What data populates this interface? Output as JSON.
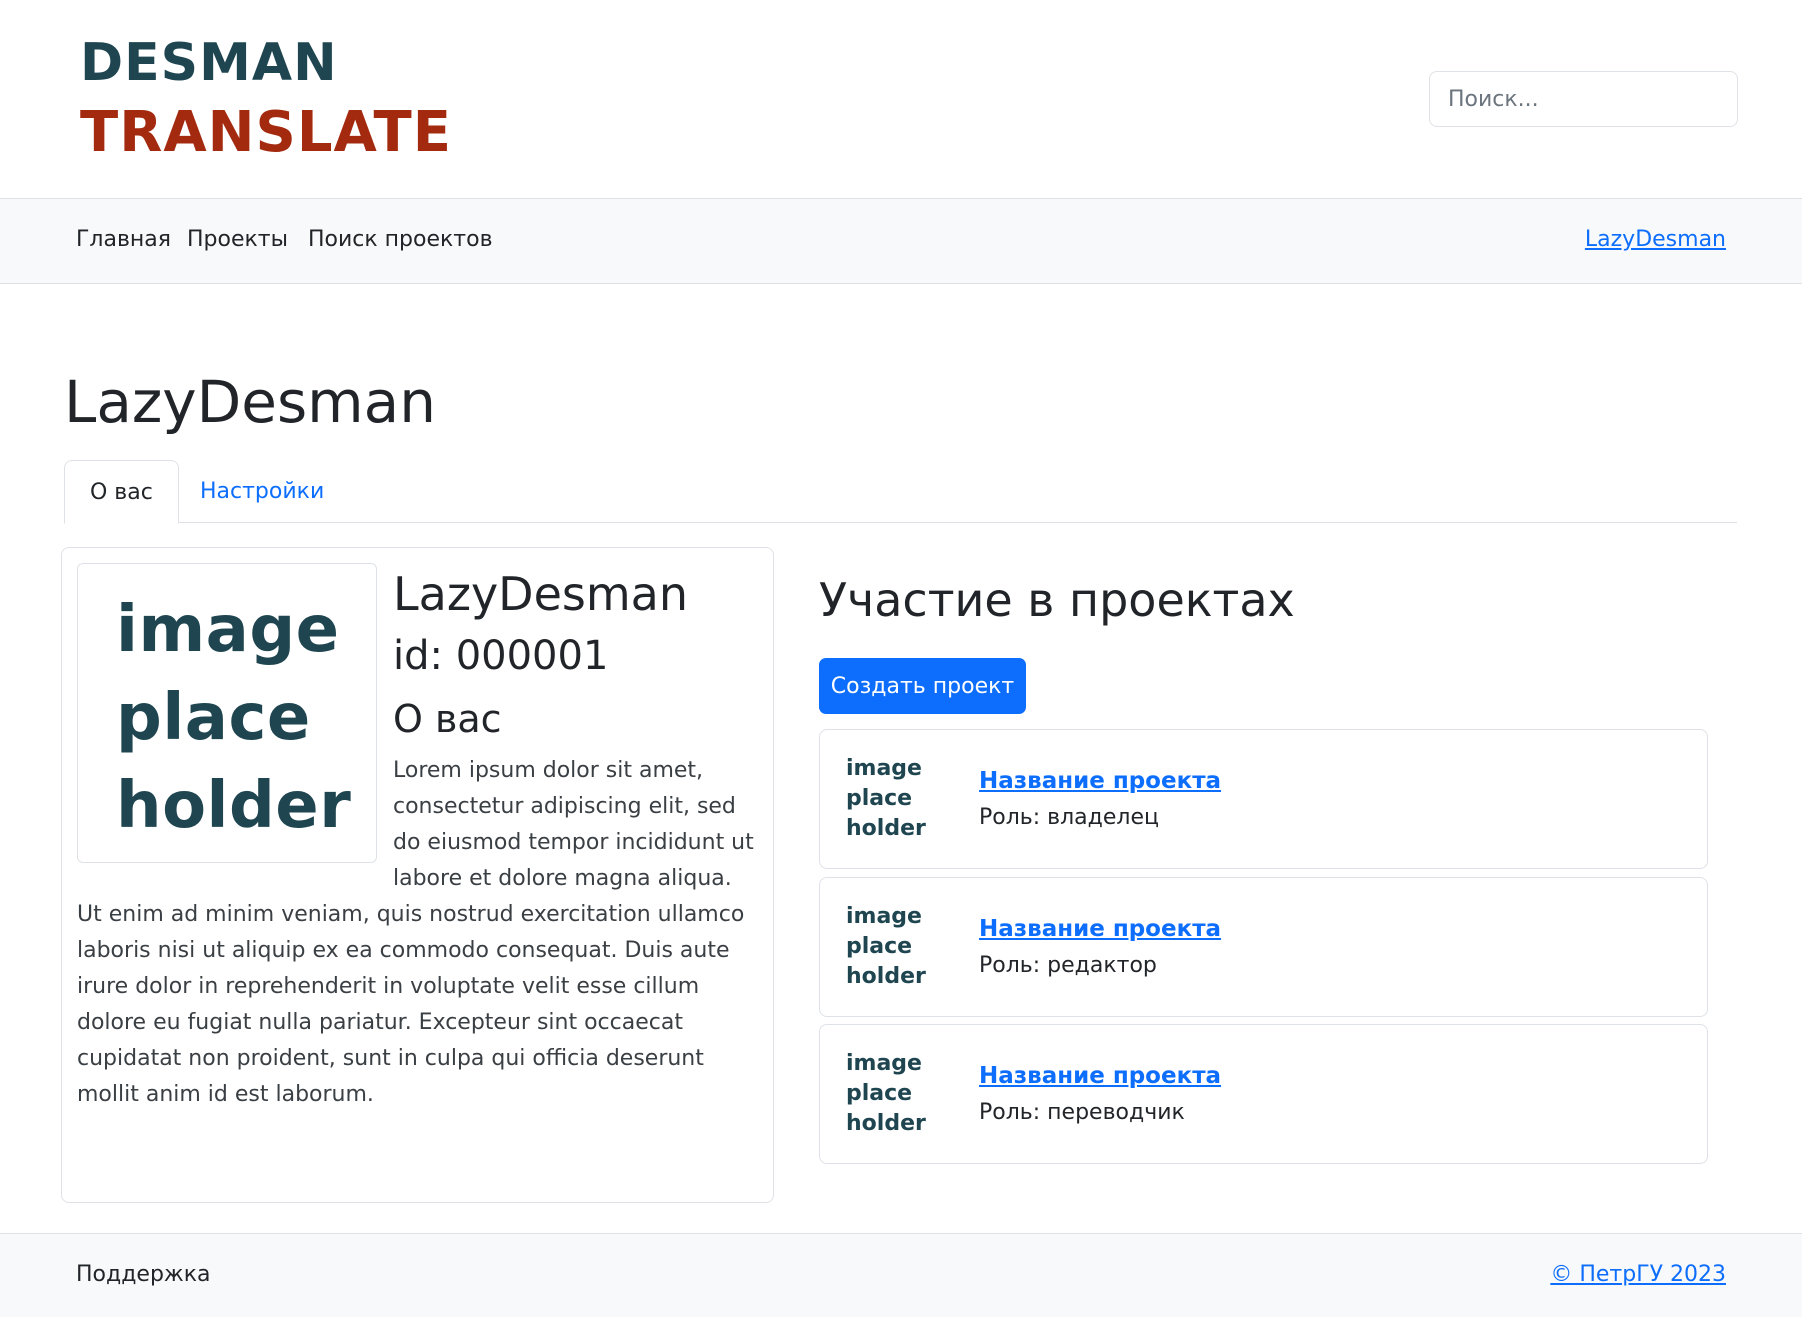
{
  "header": {
    "logo_line1": "DESMAN",
    "logo_line2": "TRANSLATE",
    "search_placeholder": "Поиск..."
  },
  "navbar": {
    "items": [
      {
        "label": "Главная"
      },
      {
        "label": "Проекты"
      },
      {
        "label": "Поиск проектов"
      }
    ],
    "user_link": "LazyDesman"
  },
  "page": {
    "title": "LazyDesman",
    "tabs": [
      {
        "label": "О вас",
        "active": true
      },
      {
        "label": "Настройки",
        "active": false
      }
    ]
  },
  "profile": {
    "avatar_placeholder": [
      "image",
      "place",
      "holder"
    ],
    "name": "LazyDesman",
    "id_text": "id: 000001",
    "about_heading": "О вас",
    "about_text": "Lorem ipsum dolor sit amet, consectetur adipiscing elit, sed do eiusmod tempor incididunt ut labore et dolore magna aliqua. Ut enim ad minim veniam, quis nostrud exercitation ullamco laboris nisi ut aliquip ex ea commodo consequat. Duis aute irure dolor in reprehenderit in voluptate velit esse cillum dolore eu fugiat nulla pariatur. Excepteur sint occaecat cupidatat non proident, sunt in culpa qui officia deserunt mollit anim id est laborum."
  },
  "projects": {
    "title": "Участие в проектах",
    "create_button": "Создать проект",
    "items": [
      {
        "thumb": [
          "image",
          "place",
          "holder"
        ],
        "name": "Название проекта",
        "role": "Роль: владелец"
      },
      {
        "thumb": [
          "image",
          "place",
          "holder"
        ],
        "name": "Название проекта",
        "role": "Роль: редактор"
      },
      {
        "thumb": [
          "image",
          "place",
          "holder"
        ],
        "name": "Название проекта",
        "role": "Роль: переводчик"
      }
    ]
  },
  "footer": {
    "support": "Поддержка",
    "copyright": "© ПетрГУ 2023"
  },
  "colors": {
    "logo_dark": "#1f4650",
    "logo_red": "#a42a0f",
    "primary": "#0d6efd",
    "nav_bg": "#f8f9fa",
    "border": "#dee2e6"
  }
}
